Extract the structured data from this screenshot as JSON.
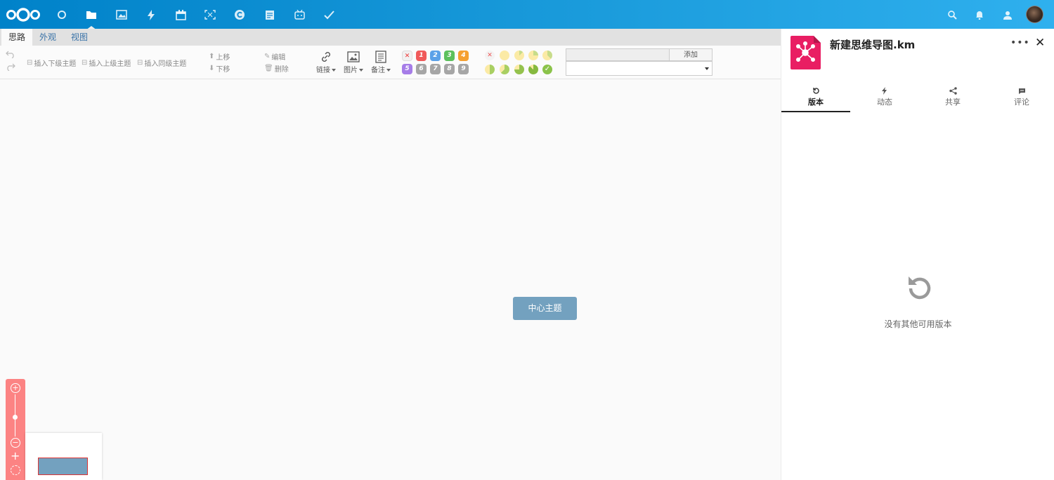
{
  "topbar": {
    "apps": [
      "dashboard",
      "files",
      "photos",
      "activity",
      "calendar",
      "screenshot",
      "contacts",
      "notes",
      "deck",
      "tasks"
    ],
    "active_app": "files",
    "right_icons": [
      "search-icon",
      "notifications-icon",
      "contacts-icon"
    ]
  },
  "editor": {
    "tabs": [
      "思路",
      "外观",
      "视图"
    ],
    "active_tab": "思路",
    "toolbar": {
      "insert_child": "插入下级主题",
      "insert_parent": "插入上级主题",
      "insert_sibling": "插入同级主题",
      "move_up": "上移",
      "move_down": "下移",
      "edit": "编辑",
      "delete": "删除",
      "link": "链接",
      "image": "图片",
      "note": "备注",
      "priorities": [
        "1",
        "2",
        "3",
        "4",
        "5",
        "6",
        "7",
        "8",
        "9"
      ],
      "resource_add": "添加"
    },
    "center_topic": "中心主题"
  },
  "sidebar": {
    "file_name": "新建思维导图.km",
    "tabs": [
      {
        "icon": "history-icon",
        "label": "版本"
      },
      {
        "icon": "activity-icon",
        "label": "动态"
      },
      {
        "icon": "share-icon",
        "label": "共享"
      },
      {
        "icon": "comment-icon",
        "label": "评论"
      }
    ],
    "active_tab": "版本",
    "empty_message": "没有其他可用版本"
  },
  "colors": {
    "header": "#0082c9",
    "center_node": "#73a1bf",
    "zoom_pane": "#fc8383",
    "file_icon": "#e91e63"
  }
}
